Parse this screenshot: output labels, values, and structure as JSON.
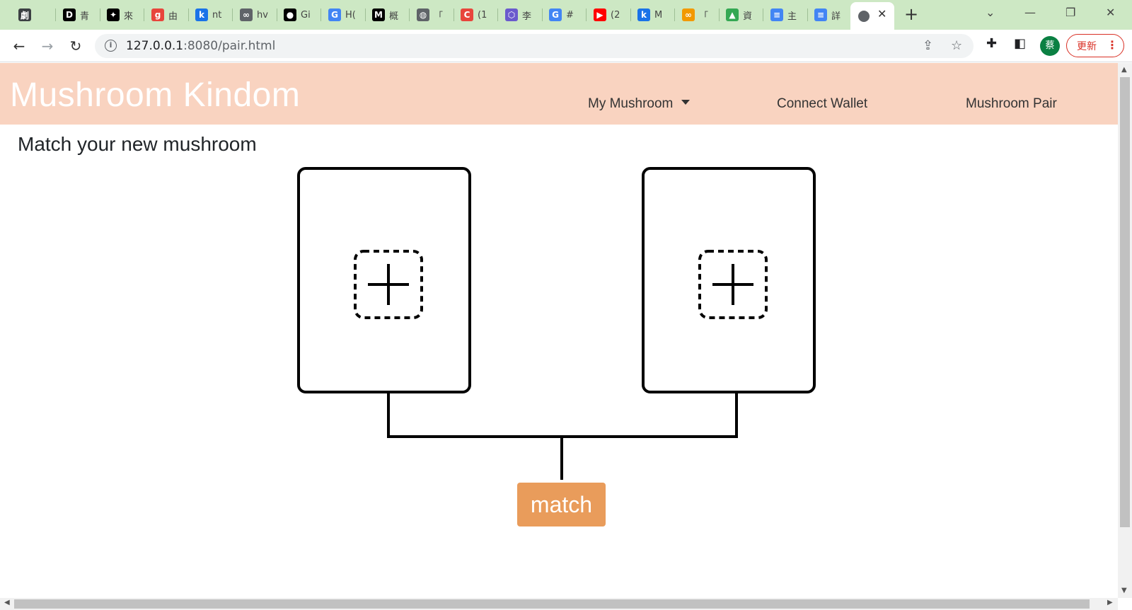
{
  "browser": {
    "tabs": [
      {
        "icon": "drama-tab-icon",
        "glyph": "劇",
        "color": "#3c4043",
        "title": ""
      },
      {
        "icon": "d-tab-icon",
        "glyph": "D",
        "color": "#000000",
        "title": "青"
      },
      {
        "icon": "maple-leaf-tab-icon",
        "glyph": "✦",
        "color": "#000000",
        "title": "來"
      },
      {
        "icon": "g-red-tab-icon",
        "glyph": "g",
        "color": "#e8453c",
        "title": "由"
      },
      {
        "icon": "k-tab-icon",
        "glyph": "k",
        "color": "#1a73e8",
        "title": "nt"
      },
      {
        "icon": "infinity-tab-icon",
        "glyph": "∞",
        "color": "#5f6368",
        "title": "hv"
      },
      {
        "icon": "github-tab-icon",
        "glyph": "●",
        "color": "#000000",
        "title": "Gi"
      },
      {
        "icon": "google-tab-icon",
        "glyph": "G",
        "color": "#4285f4",
        "title": "H("
      },
      {
        "icon": "medium-tab-icon",
        "glyph": "M",
        "color": "#000000",
        "title": "概"
      },
      {
        "icon": "globe-tab-icon",
        "glyph": "◍",
        "color": "#5f6368",
        "title": "「"
      },
      {
        "icon": "c-tab-icon",
        "glyph": "C",
        "color": "#e8453c",
        "title": "(1"
      },
      {
        "icon": "hex-tab-icon",
        "glyph": "⬡",
        "color": "#6a5acd",
        "title": "李"
      },
      {
        "icon": "google-tab-icon-2",
        "glyph": "G",
        "color": "#4285f4",
        "title": "#"
      },
      {
        "icon": "youtube-tab-icon",
        "glyph": "▶",
        "color": "#ff0000",
        "title": "(2"
      },
      {
        "icon": "k-tab-icon-2",
        "glyph": "k",
        "color": "#1a73e8",
        "title": "M"
      },
      {
        "icon": "infinity-orange-tab-icon",
        "glyph": "∞",
        "color": "#f29900",
        "title": "「"
      },
      {
        "icon": "drive-tab-icon",
        "glyph": "▲",
        "color": "#34a853",
        "title": "資"
      },
      {
        "icon": "docs-tab-icon",
        "glyph": "≡",
        "color": "#4285f4",
        "title": "主"
      },
      {
        "icon": "docs-tab-icon-2",
        "glyph": "≡",
        "color": "#4285f4",
        "title": "詳"
      }
    ],
    "active_tab_close": "✕",
    "new_tab": "+",
    "window": {
      "dropdown": "⌄",
      "minimize": "—",
      "restore": "❐",
      "close": "✕"
    },
    "nav": {
      "back": "←",
      "forward": "→",
      "reload": "↻"
    },
    "url_host": "127.0.0.1",
    "url_path": ":8080/pair.html",
    "avatar_initial": "蔡",
    "update_label": "更新",
    "update_menu": "⋮"
  },
  "navbar": {
    "brand": "Mushroom Kindom",
    "links": {
      "my_mushroom": "My Mushroom",
      "connect_wallet": "Connect Wallet",
      "mushroom_pair": "Mushroom Pair"
    }
  },
  "main": {
    "heading": "Match your new mushroom",
    "match_button": "match"
  },
  "colors": {
    "navbar_bg": "#f9d3c0",
    "match_button_bg": "#e99c5b",
    "tabbar_bg": "#cde8c4"
  }
}
